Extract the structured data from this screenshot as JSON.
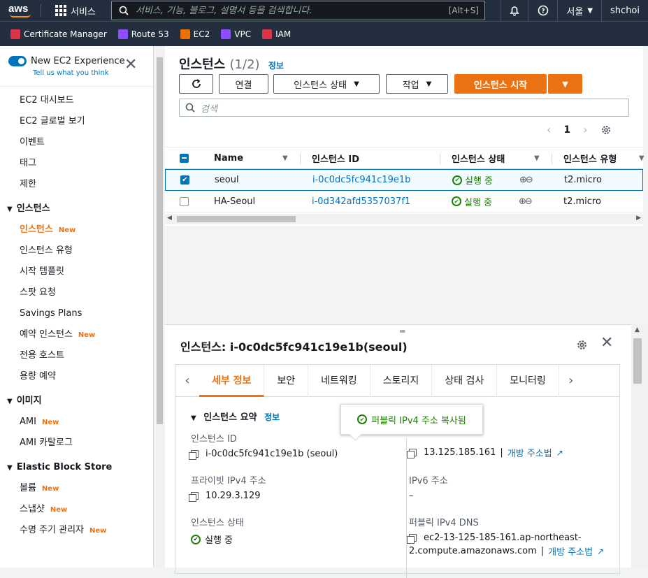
{
  "topnav": {
    "logo": "aws",
    "services_label": "서비스",
    "search_placeholder": "서비스, 기능, 블로그, 설명서 등을 검색합니다.",
    "search_shortcut": "[Alt+S]",
    "region": "서울",
    "user": "shchoi"
  },
  "favorites": [
    {
      "label": "Certificate Manager",
      "color": "#dd344c"
    },
    {
      "label": "Route 53",
      "color": "#8c4fff"
    },
    {
      "label": "EC2",
      "color": "#ed7100"
    },
    {
      "label": "VPC",
      "color": "#8c4fff"
    },
    {
      "label": "IAM",
      "color": "#dd344c"
    }
  ],
  "sidebar": {
    "new_experience_title": "New EC2 Experience",
    "new_experience_sub": "Tell us what you think",
    "top_items": [
      "EC2 대시보드",
      "EC2 글로벌 보기",
      "이벤트",
      "태그",
      "제한"
    ],
    "sections": [
      {
        "title": "인스턴스",
        "items": [
          {
            "label": "인스턴스",
            "new": "New",
            "active": true
          },
          {
            "label": "인스턴스 유형",
            "new": ""
          },
          {
            "label": "시작 템플릿",
            "new": ""
          },
          {
            "label": "스팟 요청",
            "new": ""
          },
          {
            "label": "Savings Plans",
            "new": ""
          },
          {
            "label": "예약 인스턴스",
            "new": "New"
          },
          {
            "label": "전용 호스트",
            "new": ""
          },
          {
            "label": "용량 예약",
            "new": ""
          }
        ]
      },
      {
        "title": "이미지",
        "items": [
          {
            "label": "AMI",
            "new": "New"
          },
          {
            "label": "AMI 카탈로그",
            "new": ""
          }
        ]
      },
      {
        "title": "Elastic Block Store",
        "items": [
          {
            "label": "볼륨",
            "new": "New"
          },
          {
            "label": "스냅샷",
            "new": "New"
          },
          {
            "label": "수명 주기 관리자",
            "new": "New"
          }
        ]
      }
    ]
  },
  "instances": {
    "title": "인스턴스",
    "count": "(1/2)",
    "info": "정보",
    "buttons": {
      "connect": "연결",
      "state": "인스턴스 상태",
      "actions": "작업",
      "launch": "인스턴스 시작"
    },
    "search_placeholder": "검색",
    "page": "1",
    "columns": [
      "Name",
      "인스턴스 ID",
      "인스턴스 상태",
      "인스턴스 유형"
    ],
    "rows": [
      {
        "name": "seoul",
        "id": "i-0c0dc5fc941c19e1b",
        "state": "실행 중",
        "type": "t2.micro",
        "selected": true
      },
      {
        "name": "HA-Seoul",
        "id": "i-0d342afd5357037f1",
        "state": "실행 중",
        "type": "t2.micro",
        "selected": false
      }
    ]
  },
  "detail": {
    "title": "인스턴스: i-0c0dc5fc941c19e1b(seoul)",
    "tabs": [
      "세부 정보",
      "보안",
      "네트워킹",
      "스토리지",
      "상태 검사",
      "모니터링"
    ],
    "summary": "인스턴스 요약",
    "summary_info": "정보",
    "instance_id_label": "인스턴스 ID",
    "instance_id_value": "i-0c0dc5fc941c19e1b (seoul)",
    "public_ipv4_value": "13.125.185.161",
    "open_address": "개방 주소법",
    "private_ipv4_label": "프라이빗 IPv4 주소",
    "private_ipv4_value": "10.29.3.129",
    "ipv6_label": "IPv6 주소",
    "ipv6_value": "–",
    "state_label": "인스턴스 상태",
    "state_value": "실행 중",
    "public_dns_label": "퍼블릭 IPv4 DNS",
    "public_dns_line1": "ec2-13-125-185-161.ap-northeast-",
    "public_dns_line2": "2.compute.amazonaws.com",
    "open_address2": "개방 주소법",
    "toast": "퍼블릭 IPv4 주소 복사됨"
  }
}
